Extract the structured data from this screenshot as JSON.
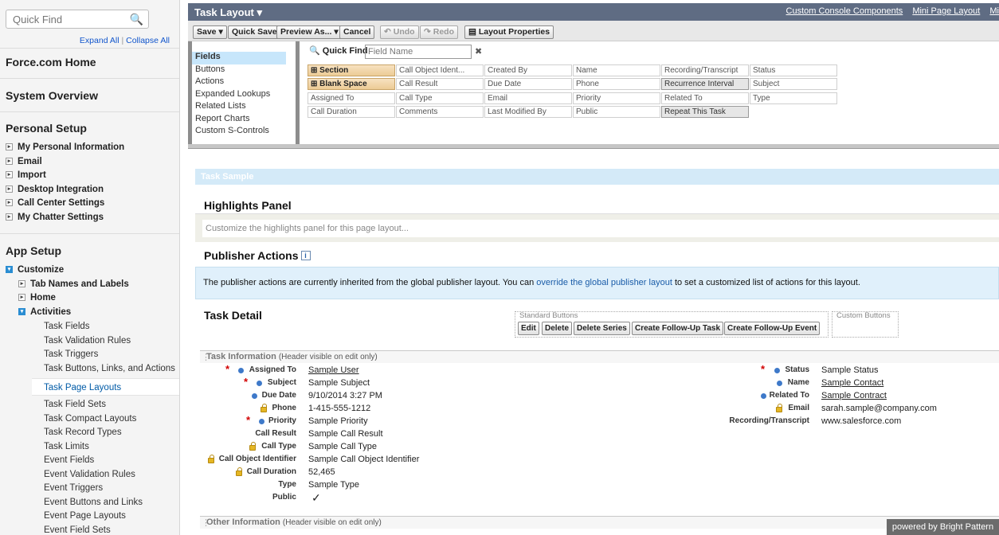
{
  "sidebar": {
    "quick_find_placeholder": "Quick Find",
    "expand_all": "Expand All",
    "collapse_all": "Collapse All",
    "link_sep": "|",
    "force_home": "Force.com Home",
    "system_overview": "System Overview",
    "personal_setup": "Personal Setup",
    "personal_items": [
      "My Personal Information",
      "Email",
      "Import",
      "Desktop Integration",
      "Call Center Settings",
      "My Chatter Settings"
    ],
    "app_setup": "App Setup",
    "customize": "Customize",
    "tab_names": "Tab Names and Labels",
    "home": "Home",
    "activities": "Activities",
    "activities_items": [
      "Task Fields",
      "Task Validation Rules",
      "Task Triggers",
      "Task Buttons, Links, and Actions",
      "Task Page Layouts",
      "Task Field Sets",
      "Task Compact Layouts",
      "Task Record Types",
      "Task Limits",
      "Event Fields",
      "Event Validation Rules",
      "Event Triggers",
      "Event Buttons and Links",
      "Event Page Layouts",
      "Event Field Sets"
    ],
    "active_item": "Task Page Layouts"
  },
  "header": {
    "title": "Task Layout",
    "links": [
      "Custom Console Components",
      "Mini Page Layout",
      "Mi"
    ]
  },
  "toolbar": {
    "save": "Save",
    "quick_save": "Quick Save",
    "preview_as": "Preview As...",
    "cancel": "Cancel",
    "undo": "Undo",
    "redo": "Redo",
    "layout_properties": "Layout Properties"
  },
  "palette": {
    "categories": [
      "Fields",
      "Buttons",
      "Actions",
      "Expanded Lookups",
      "Related Lists",
      "Report Charts",
      "Custom S-Controls"
    ],
    "quick_find_label": "Quick Find",
    "field_name_placeholder": "Field Name",
    "cells": [
      [
        "Section",
        "Call Object Ident...",
        "Created By",
        "Name",
        "Recording/Transcript",
        "Status"
      ],
      [
        "Blank Space",
        "Call Result",
        "Due Date",
        "Phone",
        "Recurrence Interval",
        "Subject"
      ],
      [
        "Assigned To",
        "Call Type",
        "Email",
        "Priority",
        "Related To",
        "Type"
      ],
      [
        "Call Duration",
        "Comments",
        "Last Modified By",
        "Public",
        "Repeat This Task",
        ""
      ]
    ]
  },
  "canvas": {
    "sample_bar": "Task Sample",
    "highlights_title": "Highlights Panel",
    "highlights_hint": "Customize the highlights panel for this page layout...",
    "publisher_title": "Publisher Actions",
    "info_icon": "i",
    "publisher_text_1": "The publisher actions are currently inherited from the global publisher layout. You can",
    "publisher_link": "override the global publisher layout",
    "publisher_text_2": "to set a customized list of actions for this layout.",
    "task_detail": "Task Detail",
    "standard_buttons_label": "Standard Buttons",
    "custom_buttons_label": "Custom Buttons",
    "buttons": [
      "Edit",
      "Delete",
      "Delete Series",
      "Create Follow-Up Task",
      "Create Follow-Up Event"
    ],
    "task_info": "Task Information",
    "task_info_note": "(Header visible on edit only)",
    "other_info": "Other Information",
    "other_info_note": "(Header visible on edit only)",
    "left_fields": [
      {
        "label": "Assigned To",
        "value": "Sample User"
      },
      {
        "label": "Subject",
        "value": "Sample Subject"
      },
      {
        "label": "Due Date",
        "value": "9/10/2014 3:27 PM"
      },
      {
        "label": "Phone",
        "value": "1-415-555-1212"
      },
      {
        "label": "Priority",
        "value": "Sample Priority"
      },
      {
        "label": "Call Result",
        "value": "Sample Call Result"
      },
      {
        "label": "Call Type",
        "value": "Sample Call Type"
      },
      {
        "label": "Call Object Identifier",
        "value": "Sample Call Object Identifier"
      },
      {
        "label": "Call Duration",
        "value": "52,465"
      },
      {
        "label": "Type",
        "value": "Sample Type"
      },
      {
        "label": "Public",
        "value": "✓"
      }
    ],
    "right_fields": [
      {
        "label": "Status",
        "value": "Sample Status"
      },
      {
        "label": "Name",
        "value": "Sample Contact"
      },
      {
        "label": "Related To",
        "value": "Sample Contract"
      },
      {
        "label": "Email",
        "value": "sarah.sample@company.com"
      },
      {
        "label": "Recording/Transcript",
        "value": "www.salesforce.com"
      }
    ]
  },
  "footer": {
    "powered": "powered by Bright Pattern"
  }
}
